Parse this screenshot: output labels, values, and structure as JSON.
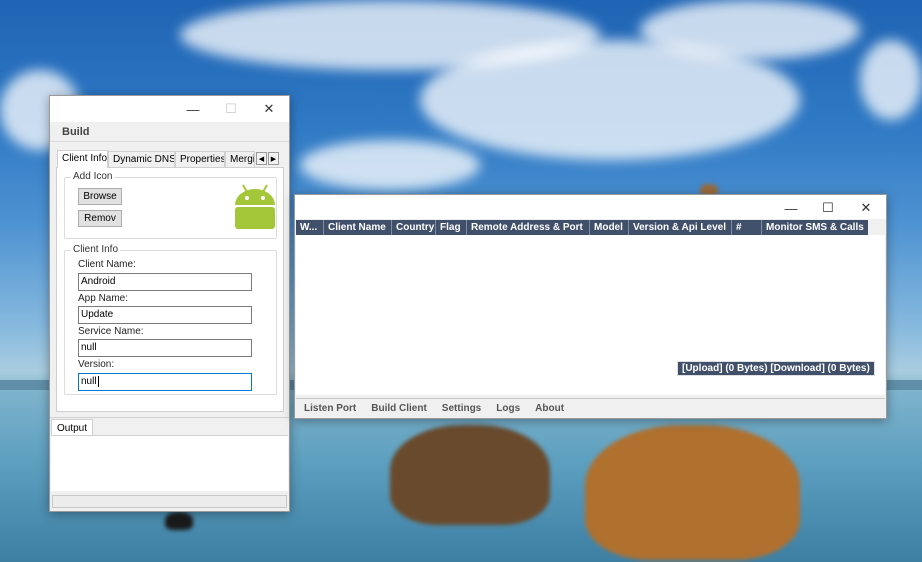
{
  "build_window": {
    "menu_title": "Build",
    "caption_minimize": "—",
    "caption_maximize": "☐",
    "caption_close": "✕",
    "tabs": [
      "Client Info",
      "Dynamic DNS",
      "Properties",
      "Mergi"
    ],
    "tab_scroll_left": "◀",
    "tab_scroll_right": "▶",
    "add_icon": {
      "group_label": "Add Icon",
      "browse_label": "Browse",
      "remove_label": "Remov",
      "icon_name": "android-robot-icon"
    },
    "client_info": {
      "group_label": "Client Info",
      "client_name_label": "Client Name:",
      "client_name_value": "Android",
      "app_name_label": "App Name:",
      "app_name_value": "Update",
      "service_name_label": "Service Name:",
      "service_name_value": "null",
      "version_label": "Version:",
      "version_value": "null"
    },
    "output_tab": "Output"
  },
  "main_window": {
    "caption_minimize": "—",
    "caption_maximize": "☐",
    "caption_close": "✕",
    "columns": [
      "W...",
      "Client Name",
      "Country",
      "Flag",
      "Remote Address & Port",
      "Model",
      "Version & Api Level",
      "#",
      "Monitor SMS & Calls"
    ],
    "transfer_status": "[Upload] (0 Bytes) [Download] (0 Bytes)",
    "menu": [
      "Listen Port",
      "Build Client",
      "Settings",
      "Logs",
      "About"
    ]
  },
  "colors": {
    "header_bg": "#40506a",
    "android_green": "#a4c639",
    "focus_border": "#0078d7"
  }
}
